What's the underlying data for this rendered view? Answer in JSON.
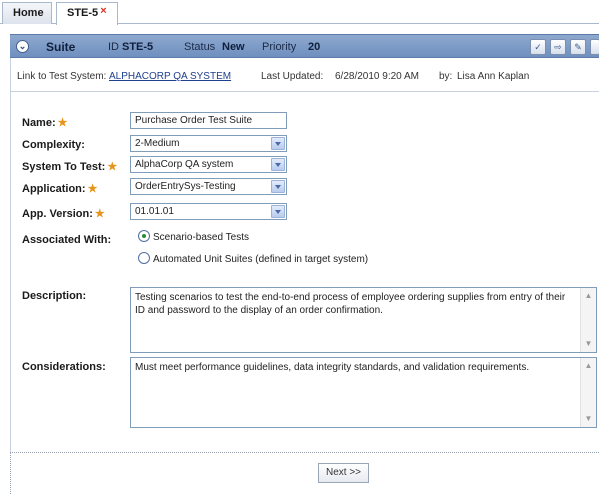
{
  "tabs": {
    "home": "Home",
    "active": "STE-5",
    "close_glyph": "×"
  },
  "header": {
    "title": "Suite",
    "id_label": "ID",
    "id_value": "STE-5",
    "status_label": "Status",
    "status_value": "New",
    "priority_label": "Priority",
    "priority_value": "20",
    "icons": [
      "spellcheck-icon",
      "export-icon",
      "attach-icon",
      "more-icon"
    ]
  },
  "info": {
    "link_label": "Link to Test System:",
    "link_value": "ALPHACORP QA SYSTEM",
    "updated_label": "Last Updated:",
    "updated_value": "6/28/2010 9:20 AM",
    "by_label": "by:",
    "by_value": "Lisa Ann Kaplan"
  },
  "form": {
    "name_label": "Name:",
    "name_value": "Purchase Order Test Suite",
    "complexity_label": "Complexity:",
    "complexity_value": "2-Medium",
    "system_label": "System To Test:",
    "system_value": "AlphaCorp QA system",
    "application_label": "Application:",
    "application_value": "OrderEntrySys-Testing",
    "version_label": "App. Version:",
    "version_value": "01.01.01",
    "associated_label": "Associated With:",
    "radio_1": "Scenario-based Tests",
    "radio_2": "Automated Unit Suites (defined in target system)",
    "description_label": "Description:",
    "description_value": "Testing scenarios to test the end-to-end process of employee ordering supplies from entry of their ID and password to the display of an order confirmation.",
    "considerations_label": "Considerations:",
    "considerations_value": "Must meet performance guidelines, data integrity standards, and validation requirements.",
    "required_marker": "★"
  },
  "footer": {
    "next_label": "Next >>"
  },
  "colors": {
    "header_bg": "#7f9cc8",
    "required_star": "#e8941a",
    "close_x": "#e0322b"
  }
}
